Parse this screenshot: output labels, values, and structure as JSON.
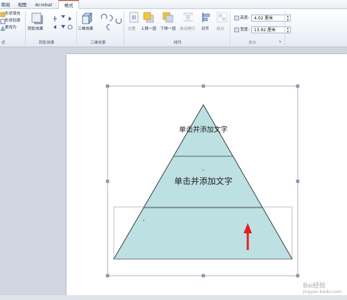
{
  "tabs": [
    {
      "label": "审阅"
    },
    {
      "label": "视图"
    },
    {
      "label": "Acrobat"
    },
    {
      "label": "格式"
    }
  ],
  "ribbon": {
    "shape_styles": {
      "fill": "形状填充",
      "outline": "形状轮廓",
      "change": "更改为",
      "group_label": "式"
    },
    "shadow": {
      "button": "阴影效果",
      "group_label": "阴影效果"
    },
    "threed": {
      "button": "三维效果",
      "group_label": "三维效果"
    },
    "arrange": {
      "position": "位置",
      "bring_forward": "上移一层",
      "send_backward": "下移一层",
      "text_wrap": "自动换行",
      "align": "对齐",
      "group": "组合",
      "group_label": "排列"
    },
    "size": {
      "height_label": "高度:",
      "height_value": "4.02 厘米",
      "width_label": "宽度:",
      "width_value": "13.92 厘米",
      "group_label": "大小"
    }
  },
  "pyramid": {
    "top_text": "单击并添加文字",
    "middle_text": "单击并添加文字",
    "fill": "#bde0e2",
    "outline": "#2f3b3c",
    "arrow_color": "#e02020"
  },
  "watermark": {
    "text": "Bai经验",
    "url": "jingyan.baidu.com"
  }
}
